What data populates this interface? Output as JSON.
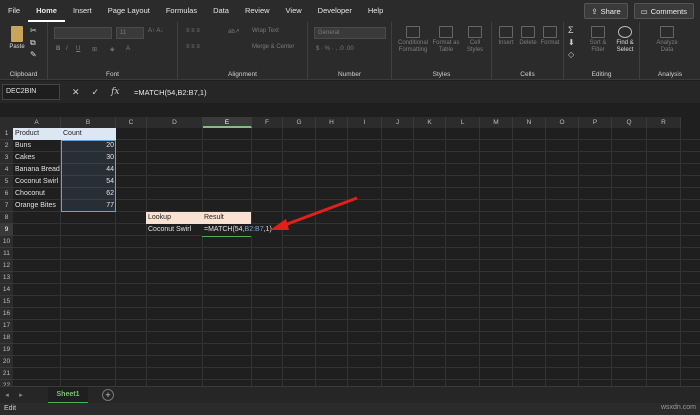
{
  "ribbon": {
    "tabs": [
      "File",
      "Home",
      "Insert",
      "Page Layout",
      "Formulas",
      "Data",
      "Review",
      "View",
      "Developer",
      "Help"
    ],
    "share_label": "Share",
    "comments_label": "Comments",
    "groups": {
      "clipboard": "Clipboard",
      "font": "Font",
      "alignment": "Alignment",
      "number": "Number",
      "styles": "Styles",
      "cells": "Cells",
      "editing": "Editing",
      "analysis": "Analysis"
    },
    "paste_label": "Paste",
    "font_size": "11",
    "wrap_text": "Wrap Text",
    "merge_center": "Merge & Center",
    "number_format": "General",
    "conditional_formatting": "Conditional Formatting",
    "format_as_table": "Format as Table",
    "cell_styles": "Cell Styles",
    "insert": "Insert",
    "delete": "Delete",
    "format": "Format",
    "sort_filter": "Sort & Filter",
    "find_select": "Find & Select",
    "analyze_data": "Analyze Data"
  },
  "formula_bar": {
    "name_box": "DEC2BIN",
    "formula": "=MATCH(54,B2:B7,1)"
  },
  "columns": [
    "A",
    "B",
    "C",
    "D",
    "E",
    "F",
    "G",
    "H",
    "I",
    "J",
    "K",
    "L",
    "M",
    "N",
    "O",
    "P",
    "Q",
    "R"
  ],
  "rows": [
    "1",
    "2",
    "3",
    "4",
    "5",
    "6",
    "7",
    "8",
    "9",
    "10",
    "11",
    "12",
    "13",
    "14",
    "15",
    "16",
    "17",
    "18",
    "19",
    "20",
    "21",
    "22",
    "23"
  ],
  "table": {
    "header_product": "Product",
    "header_count": "Count",
    "products": [
      "Buns",
      "Cakes",
      "Banana Bread",
      "Coconut Swirl",
      "Choconut",
      "Orange Bites"
    ],
    "counts": [
      "20",
      "30",
      "44",
      "54",
      "62",
      "77"
    ]
  },
  "lookup": {
    "label_lookup": "Lookup",
    "label_result": "Result",
    "lookup_value": "Coconut Swirl",
    "editing_formula_prefix": "=MATCH(54,",
    "editing_formula_ref": "B2:B7",
    "editing_formula_suffix": ",1)"
  },
  "sheet": {
    "tab_name": "Sheet1"
  },
  "status": {
    "mode": "Edit",
    "watermark": "wsxdn.com"
  },
  "colors": {
    "accent_green": "#4caf50",
    "arrow_red": "#e0201c",
    "header_fill": "#dde7f3",
    "lookup_fill": "#f9e2d2"
  }
}
